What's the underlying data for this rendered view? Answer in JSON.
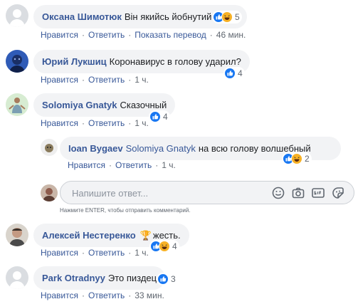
{
  "actions": {
    "like": "Нравится",
    "reply": "Ответить",
    "translate": "Показать перевод"
  },
  "comments": [
    {
      "name": "Оксана Шимотюк",
      "text": "Він якийсь йобнутий",
      "reactions": "5",
      "time": "46 мин."
    },
    {
      "name": "Юрий Лукшиц",
      "text": "Коронавирус в голову ударил?",
      "reactions": "4",
      "time": "1 ч."
    },
    {
      "name": "Solomiya Gnatyk",
      "text": "Сказочный",
      "reactions": "4",
      "time": "1 ч."
    },
    {
      "name": "Ioan Bygaev",
      "mention": "Solomiya Gnatyk",
      "text": "на всю голову волшебный",
      "reactions": "2",
      "time": "1 ч."
    },
    {
      "name": "Алексей Нестеренко",
      "text": "жесть.",
      "emoji": "🏆",
      "reactions": "4",
      "time": "1 ч."
    },
    {
      "name": "Park Otradnyy",
      "text": "Это пиздец",
      "reactions": "3",
      "time": "33 мин."
    }
  ],
  "compose": {
    "placeholder": "Напишите ответ...",
    "hint": "Нажмите ENTER, чтобы отправить комментарий."
  },
  "colors": {
    "link": "#385898",
    "like": "#1877f2",
    "haha": "#f7b125",
    "bubble": "#f2f3f5"
  }
}
